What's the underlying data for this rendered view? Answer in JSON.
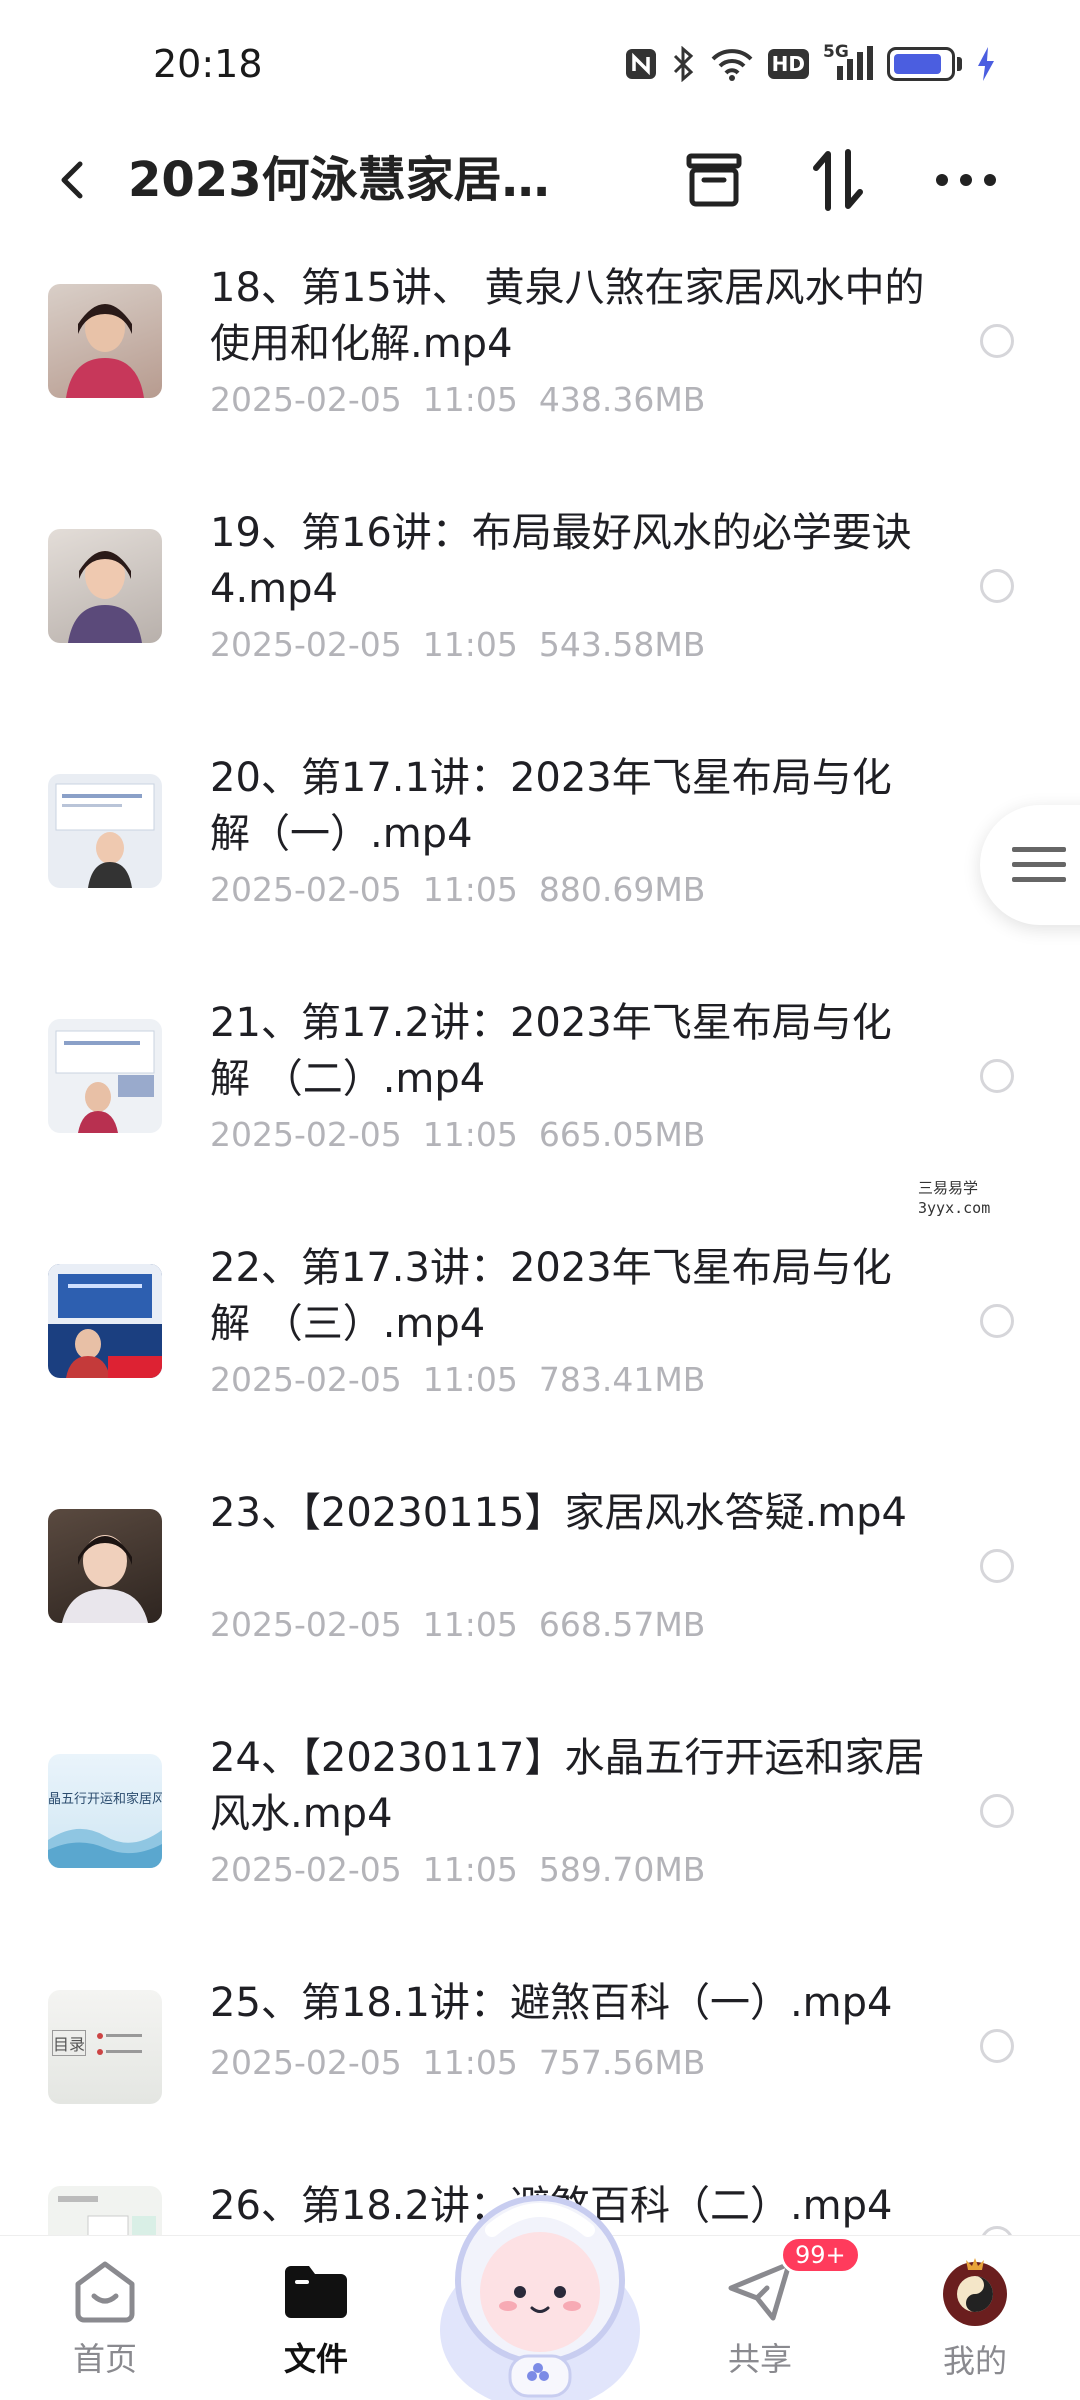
{
  "status_bar": {
    "time": "20:18",
    "icons": [
      "nfc-icon",
      "bluetooth-icon",
      "wifi-icon",
      "hd-icon",
      "5g-signal-icon",
      "battery-icon",
      "charging-icon"
    ],
    "hd_label": "HD",
    "network_label": "5G",
    "battery_level": 0.75,
    "battery_color": "#4b5ee0"
  },
  "header": {
    "title": "2023何泳慧家居风...",
    "actions": [
      "archive-icon",
      "sort-icon",
      "more-icon"
    ]
  },
  "files": [
    {
      "name": "18、第15讲、 黄泉八煞在家居风水中的使用和化解.mp4",
      "date": "2025-02-05",
      "time": "11:05",
      "size": "438.36MB"
    },
    {
      "name": "19、第16讲：布局最好风水的必学要诀4.mp4",
      "date": "2025-02-05",
      "time": "11:05",
      "size": "543.58MB"
    },
    {
      "name": "20、第17.1讲：2023年飞星布局与化解（一）.mp4",
      "date": "2025-02-05",
      "time": "11:05",
      "size": "880.69MB"
    },
    {
      "name": "21、第17.2讲：2023年飞星布局与化解 （二）.mp4",
      "date": "2025-02-05",
      "time": "11:05",
      "size": "665.05MB"
    },
    {
      "name": "22、第17.3讲：2023年飞星布局与化解 （三）.mp4",
      "date": "2025-02-05",
      "time": "11:05",
      "size": "783.41MB"
    },
    {
      "name": "23、【20230115】家居风水答疑.mp4",
      "date": "2025-02-05",
      "time": "11:05",
      "size": "668.57MB"
    },
    {
      "name": "24、【20230117】水晶五行开运和家居风水.mp4",
      "date": "2025-02-05",
      "time": "11:05",
      "size": "589.70MB"
    },
    {
      "name": "25、第18.1讲：避煞百科（一）.mp4",
      "date": "2025-02-05",
      "time": "11:05",
      "size": "757.56MB"
    },
    {
      "name": "26、第18.2讲：避煞百科（二）.mp4",
      "date": "",
      "time": "",
      "size": ""
    }
  ],
  "thumb_texts": {
    "t24": "晶五行开运和家居风",
    "t25": "目录"
  },
  "watermark": {
    "line1": "三易易学",
    "line2": "3yyx.com"
  },
  "bottom_nav": {
    "home": "首页",
    "files": "文件",
    "share": "共享",
    "mine": "我的",
    "share_badge": "99+"
  },
  "colors": {
    "accent_badge": "#ff3b5c",
    "meta_text": "#b3b3b8"
  }
}
